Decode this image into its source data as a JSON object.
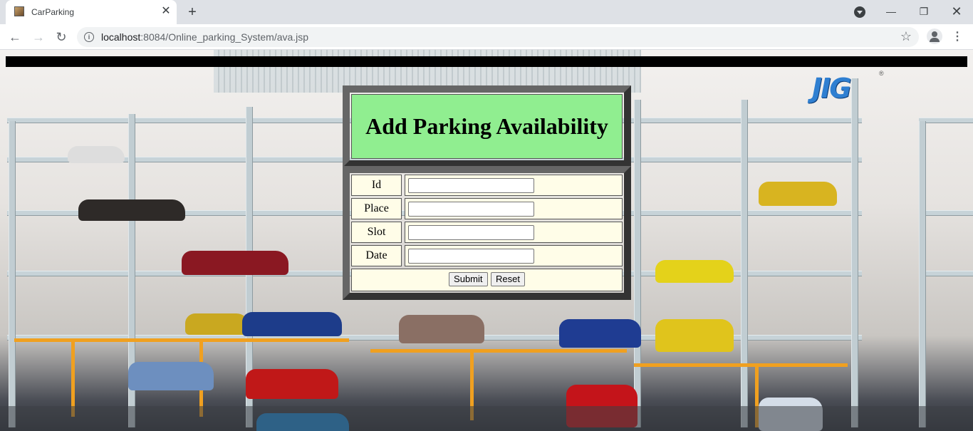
{
  "browser": {
    "tab_title": "CarParking",
    "tab_close": "✕",
    "new_tab": "+",
    "url_host": "localhost",
    "url_path": ":8084/Online_parking_System/ava.jsp",
    "icons": [
      "favicon-icon",
      "close-icon",
      "plus-icon",
      "tab-search-icon",
      "minimize-icon",
      "restore-icon",
      "close-window-icon",
      "back-icon",
      "forward-icon",
      "reload-icon",
      "info-icon",
      "star-icon",
      "profile-icon",
      "menu-icon"
    ]
  },
  "page": {
    "logo_text": "JIG",
    "logo_mark": "®",
    "heading": "Add Parking Availability",
    "form": {
      "fields": [
        {
          "label": "Id",
          "value": ""
        },
        {
          "label": "Place",
          "value": ""
        },
        {
          "label": "Slot",
          "value": ""
        },
        {
          "label": "Date",
          "value": ""
        }
      ],
      "submit_label": "Submit",
      "reset_label": "Reset"
    },
    "colors": {
      "heading_bg": "#90ee90",
      "cell_bg": "#fffde8",
      "frame": "#555555",
      "top_bar": "#000000"
    }
  }
}
